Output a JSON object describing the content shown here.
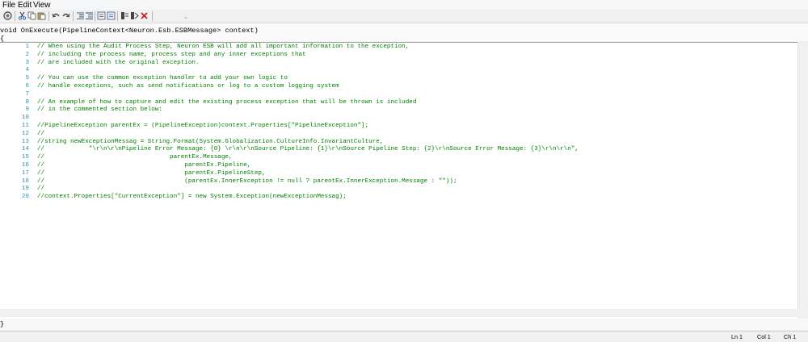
{
  "menu": {
    "items": [
      "File",
      "Edit",
      "View"
    ]
  },
  "toolbar": {
    "icons": [
      "connect-icon",
      "cut-icon",
      "copy-icon",
      "paste-icon",
      "undo-icon",
      "redo-icon",
      "outdent-icon",
      "indent-icon",
      "comment-icon",
      "uncomment-icon",
      "bookmark-icon",
      "bookmark-next-icon",
      "close-icon"
    ],
    "overflow_glyph": "⌄",
    "accent": "#2b6cb0",
    "delete_color": "#d11b1b"
  },
  "signature": {
    "line1": "void OnExecute(PipelineContext<Neuron.Esb.ESBMessage> context)",
    "line2": "{"
  },
  "editor": {
    "line_number_color": "#2b91af",
    "comment_color": "#008000",
    "lines": [
      {
        "n": "1",
        "text": "// When using the Audit Process Step, Neuron ESB will add all important information to the exception,"
      },
      {
        "n": "2",
        "text": "// including the process name, process step and any inner exceptions that"
      },
      {
        "n": "3",
        "text": "// are included with the original exception."
      },
      {
        "n": "4",
        "text": ""
      },
      {
        "n": "5",
        "text": "// You can use the common exception handler to add your own logic to"
      },
      {
        "n": "6",
        "text": "// handle exceptions, such as send notifications or log to a custom logging system"
      },
      {
        "n": "7",
        "text": ""
      },
      {
        "n": "8",
        "text": "// An example of how to capture and edit the existing process exception that will be thrown is included"
      },
      {
        "n": "9",
        "text": "// in the commented section below:"
      },
      {
        "n": "10",
        "text": ""
      },
      {
        "n": "11",
        "text": "//PipelineException parentEx = (PipelineException)context.Properties[\"PipelineException\"];"
      },
      {
        "n": "12",
        "text": "//"
      },
      {
        "n": "13",
        "text": "//string newExceptionMessag = String.Format(System.Globalization.CultureInfo.InvariantCulture,"
      },
      {
        "n": "14",
        "text": "//            \"\\r\\n\\r\\nPipeline Error Message: {0} \\r\\n\\r\\nSource Pipeline: {1}\\r\\nSource Pipeline Step: {2}\\r\\nSource Error Message: {3}\\r\\n\\r\\n\","
      },
      {
        "n": "15",
        "text": "//                                  parentEx.Message,"
      },
      {
        "n": "16",
        "text": "//                                      parentEx.Pipeline,"
      },
      {
        "n": "17",
        "text": "//                                      parentEx.PipelineStep,"
      },
      {
        "n": "18",
        "text": "//                                      (parentEx.InnerException != null ? parentEx.InnerException.Message : \"\"));"
      },
      {
        "n": "19",
        "text": "//"
      },
      {
        "n": "20",
        "text": "//context.Properties[\"CurrentException\"] = new System.Exception(newExceptionMessag);"
      }
    ]
  },
  "footer": {
    "closing_brace": "}"
  },
  "status": {
    "ln": "Ln 1",
    "col": "Col 1",
    "ch": "Ch 1"
  }
}
